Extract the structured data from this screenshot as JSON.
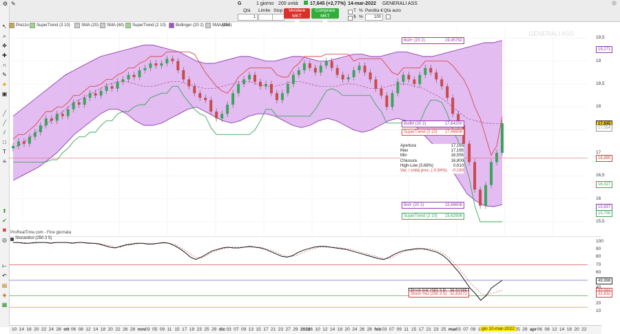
{
  "toolbar": {
    "symbol_letter": "G",
    "timeframe": "1 giorno",
    "units": "200 unità",
    "quote": "17,645 (+2,77%)",
    "date": "14-mar-2022",
    "instrument": "GENERALI ASS",
    "qty_label": "Qtà",
    "qty_value": "1",
    "limit_label": "Limite",
    "stop_label": "Stop",
    "sell_label": "Vendere MKT",
    "buy_label": "Comprare MKT",
    "t_label": "T",
    "s_label": "$",
    "pct_label": "%",
    "loss_label": "Perdita €",
    "loss_value": "100",
    "auto_qty_label": "Qtà auto",
    "sell_color": "#d9302c",
    "buy_color": "#2fae3a"
  },
  "legend": [
    {
      "label": "Prezzo",
      "color": "#c9a64a"
    },
    {
      "label": "SuperTrend (3 10)",
      "color": "#9ad98a"
    },
    {
      "label": "SMA (20)",
      "color": "#cccccc"
    },
    {
      "label": "SMA (60)",
      "color": "#cccccc"
    },
    {
      "label": "SuperTrend (2 10)",
      "color": "#9ad98a"
    },
    {
      "label": "Bollinger (20 2)",
      "color": "#a24fc9"
    },
    {
      "label": "SMA (250)",
      "color": "#cccccc"
    },
    {
      "label": "Altro",
      "color": ""
    }
  ],
  "watermark": "GENERALI ASS",
  "footer_note": "ProRealTime.com - Fine giornata",
  "osc_title": "Stocastico (250 3 5)",
  "price_axis": [
    "19,5",
    "19",
    "18,5",
    "18",
    "17,5",
    "17",
    "16,5",
    "16",
    "15,5"
  ],
  "price_tags": [
    {
      "value": "19,271",
      "color": "#8e3bb0"
    },
    {
      "value": "17,645",
      "color": "#222222",
      "bg": "#ffd400"
    },
    {
      "value": "17,554",
      "color": "#999999"
    },
    {
      "value": "16,890",
      "color": "#d04040"
    },
    {
      "value": "16,327",
      "color": "#3aa55a"
    },
    {
      "value": "15,837",
      "color": "#8e3bb0"
    },
    {
      "value": "15,700",
      "color": "#3aa55a"
    }
  ],
  "indicator_labels": {
    "boll_up": {
      "name": "Boll+ (20 2)",
      "value": "19,45792"
    },
    "boll_mid": {
      "name": "BollM (20 2)",
      "value": "17,64200"
    },
    "supertrend_red": {
      "name": "SuperTrend (3 10)",
      "value": "17,46908"
    },
    "boll_down": {
      "name": "Boll- (20 2)",
      "value": "15,86608"
    },
    "supertrend_green": {
      "name": "SuperTrend (2 10)",
      "value": "15,62906"
    }
  },
  "ohlc": [
    {
      "k": "Apertura",
      "v": "17,165"
    },
    {
      "k": "Max",
      "v": "17,165"
    },
    {
      "k": "Min",
      "v": "16,555"
    },
    {
      "k": "Chiusura",
      "v": "16,800"
    },
    {
      "k": "High-Low (3,68%)",
      "v": "0,610"
    },
    {
      "k": "Var. / unità prec. (-0,94%)",
      "v": "-0,160"
    }
  ],
  "osc_axis": [
    "100",
    "90",
    "80",
    "70",
    "60",
    "50",
    "40",
    "30",
    "20",
    "10"
  ],
  "osc_tags": [
    {
      "value": "49,998",
      "color": "#222222"
    },
    {
      "value": "37,031",
      "color": "#d04040"
    },
    {
      "value": "32,832",
      "color": "#d04040"
    }
  ],
  "stoch_labels": {
    "k": {
      "name": "Stoch %K (250 3 5)",
      "value": "36,91385"
    },
    "d": {
      "name": "Stoch %D (250 3 5)",
      "value": "32,83272"
    }
  },
  "x_labels": [
    "10",
    "14",
    "16",
    "20",
    "22",
    "24",
    "28",
    "ott",
    "06",
    "08",
    "12",
    "14",
    "18",
    "20",
    "22",
    "26",
    "28",
    "nov",
    "03",
    "05",
    "09",
    "11",
    "15",
    "17",
    "19",
    "23",
    "25",
    "29",
    "dic",
    "03",
    "07",
    "09",
    "13",
    "15",
    "17",
    "21",
    "23",
    "27",
    "29",
    "2022",
    "06",
    "10",
    "12",
    "14",
    "18",
    "20",
    "24",
    "26",
    "28",
    "feb",
    "03",
    "07",
    "09",
    "11",
    "15",
    "17",
    "21",
    "23",
    "25",
    "mar",
    "03",
    "07",
    "09",
    "11",
    "15",
    "17",
    "21",
    "23",
    "25",
    "29",
    "apr",
    "06",
    "08",
    "12",
    "14",
    "18",
    "20",
    "22"
  ],
  "x_highlight": "gio 10-mar-2022",
  "chart_data": {
    "type": "line",
    "title": "GENERALI ASS",
    "xlabel": "",
    "ylabel": "",
    "ylim": [
      15.2,
      19.7
    ],
    "close": [
      17.15,
      17.25,
      17.2,
      17.35,
      17.45,
      17.6,
      17.75,
      17.7,
      17.85,
      17.8,
      17.95,
      18.1,
      18.05,
      18.2,
      18.3,
      18.25,
      18.35,
      18.45,
      18.4,
      18.55,
      18.6,
      18.7,
      18.65,
      18.8,
      18.85,
      18.95,
      18.9,
      18.95,
      19.05,
      19.0,
      18.8,
      18.6,
      18.45,
      18.3,
      18.2,
      18.15,
      17.9,
      17.75,
      17.85,
      18.05,
      18.3,
      18.5,
      18.6,
      18.7,
      18.55,
      18.45,
      18.5,
      18.3,
      18.15,
      18.3,
      18.5,
      18.7,
      18.8,
      18.95,
      18.85,
      18.75,
      18.9,
      19.0,
      18.85,
      18.7,
      18.6,
      18.65,
      18.8,
      18.9,
      18.75,
      18.6,
      18.4,
      18.25,
      18.0,
      18.3,
      18.55,
      18.7,
      18.6,
      18.5,
      18.7,
      18.85,
      18.75,
      18.6,
      18.45,
      18.2,
      17.85,
      17.6,
      17.2,
      16.8,
      16.2,
      15.85,
      16.3,
      16.8,
      17.0,
      17.645
    ],
    "series": [
      {
        "name": "Boll+ (20 2)",
        "values": [
          17.8,
          17.95,
          18.1,
          18.25,
          18.4,
          18.55,
          18.7,
          18.8,
          18.9,
          19.0,
          19.1,
          19.15,
          19.2,
          19.25,
          19.3,
          19.35,
          19.35,
          19.3,
          19.25,
          19.2,
          19.1,
          19.0,
          18.95,
          18.95,
          19.0,
          19.05,
          19.1,
          19.1,
          19.05,
          19.0,
          19.0,
          19.05,
          19.1,
          19.1,
          19.05,
          19.0,
          19.0,
          19.05,
          19.1,
          19.15,
          19.15,
          19.1,
          19.1,
          19.15,
          19.2,
          19.2,
          19.15,
          19.1,
          19.1,
          19.15,
          19.2,
          19.25,
          19.3,
          19.35,
          19.4,
          19.4,
          19.45
        ]
      },
      {
        "name": "Boll- (20 2)",
        "values": [
          16.4,
          16.5,
          16.6,
          16.7,
          16.85,
          17.0,
          17.2,
          17.4,
          17.55,
          17.7,
          17.85,
          17.95,
          17.95,
          17.85,
          17.7,
          17.6,
          17.6,
          17.65,
          17.75,
          17.85,
          17.95,
          18.0,
          17.9,
          17.8,
          17.7,
          17.65,
          17.7,
          17.8,
          17.85,
          17.85,
          17.8,
          17.7,
          17.6,
          17.55,
          17.6,
          17.7,
          17.75,
          17.7,
          17.6,
          17.5,
          17.45,
          17.5,
          17.6,
          17.7,
          17.75,
          17.7,
          17.6,
          17.4,
          17.2,
          17.0,
          16.7,
          16.4,
          16.1,
          15.95,
          15.85,
          15.83,
          15.87
        ]
      },
      {
        "name": "BollM (20 2)",
        "values": [
          17.1,
          17.2,
          17.35,
          17.5,
          17.65,
          17.8,
          17.95,
          18.1,
          18.2,
          18.3,
          18.4,
          18.5,
          18.55,
          18.55,
          18.5,
          18.45,
          18.45,
          18.5,
          18.55,
          18.55,
          18.5,
          18.45,
          18.4,
          18.4,
          18.45,
          18.5,
          18.55,
          18.55,
          18.5,
          18.45,
          18.45,
          18.5,
          18.55,
          18.55,
          18.5,
          18.45,
          18.45,
          18.45,
          18.5,
          18.5,
          18.45,
          18.4,
          18.4,
          18.45,
          18.5,
          18.5,
          18.45,
          18.4,
          18.3,
          18.2,
          18.05,
          17.9,
          17.75,
          17.7,
          17.65,
          17.64,
          17.64
        ]
      }
    ],
    "stochastic": {
      "k": [
        99,
        99,
        98,
        98,
        99,
        99,
        99,
        98,
        99,
        99,
        99,
        98,
        99,
        99,
        98,
        98,
        97,
        95,
        93,
        92,
        94,
        96,
        97,
        98,
        98,
        97,
        97,
        98,
        99,
        98,
        95,
        91,
        86,
        80,
        77,
        80,
        84,
        88,
        90,
        92,
        93,
        92,
        92,
        93,
        94,
        93,
        92,
        90,
        87,
        84,
        81,
        80,
        82,
        86,
        89,
        91,
        93,
        94,
        94,
        93,
        92,
        91,
        90,
        88,
        86,
        84,
        82,
        80,
        78,
        77,
        80,
        84,
        87,
        89,
        90,
        91,
        91,
        90,
        88,
        86,
        82,
        76,
        68,
        60,
        50,
        40,
        33,
        24,
        30,
        40,
        45,
        50
      ],
      "d": [
        99,
        99,
        99,
        98,
        98,
        99,
        99,
        99,
        99,
        99,
        99,
        99,
        99,
        99,
        99,
        98,
        98,
        96,
        95,
        93,
        93,
        95,
        96,
        97,
        98,
        98,
        98,
        98,
        98,
        98,
        97,
        93,
        89,
        84,
        80,
        79,
        82,
        86,
        89,
        91,
        92,
        93,
        93,
        93,
        93,
        93,
        93,
        91,
        89,
        86,
        83,
        81,
        81,
        83,
        86,
        89,
        91,
        93,
        93,
        93,
        93,
        92,
        91,
        90,
        88,
        86,
        84,
        82,
        80,
        78,
        78,
        81,
        85,
        88,
        89,
        90,
        91,
        91,
        90,
        88,
        85,
        80,
        73,
        65,
        56,
        47,
        40,
        33,
        31,
        33,
        35,
        37
      ]
    },
    "stoch_levels": [
      70,
      50,
      30,
      15
    ]
  }
}
